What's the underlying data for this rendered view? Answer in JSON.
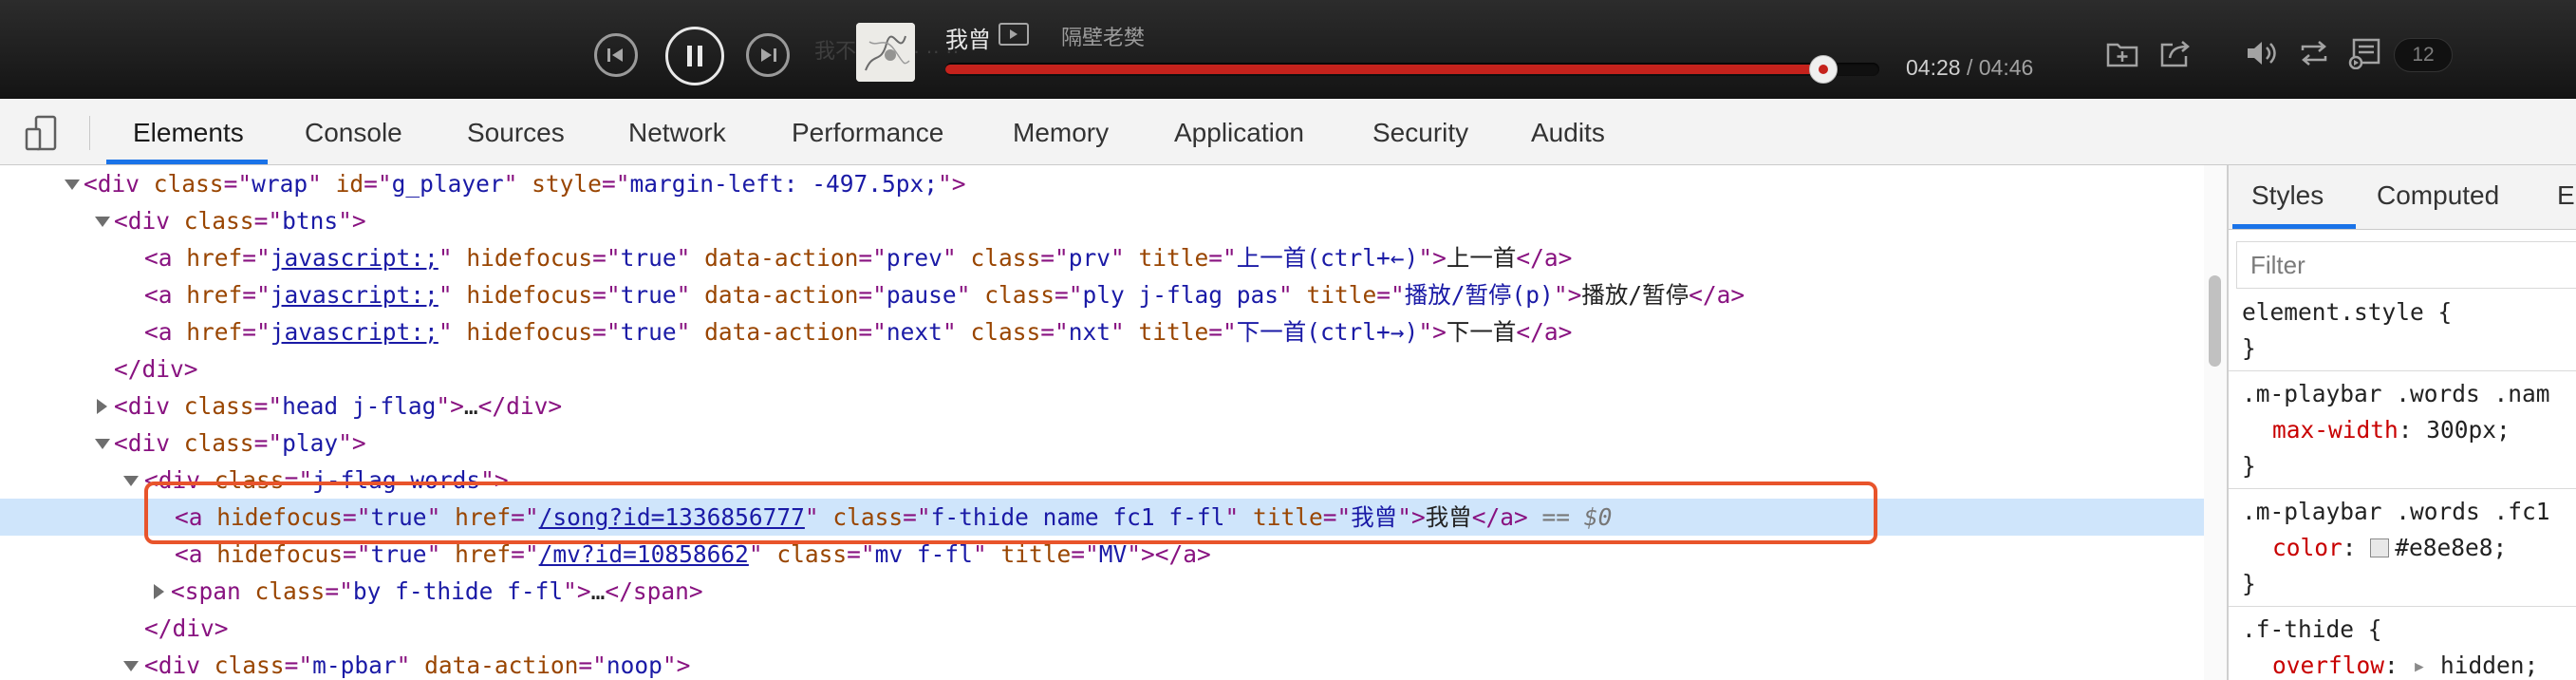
{
  "player": {
    "song": "我曾",
    "artist": "隔壁老樊",
    "ghost_text": "我不··· 1 · · ·· ··",
    "current_time": "04:28",
    "total_time": "04:46",
    "progress": 0.94,
    "playlist_count": "12",
    "colors": {
      "accent": "#c5221c",
      "bar": "#1e1e1e"
    }
  },
  "devtools": {
    "tabs": [
      {
        "label": "Elements",
        "active": true
      },
      {
        "label": "Console"
      },
      {
        "label": "Sources"
      },
      {
        "label": "Network"
      },
      {
        "label": "Performance"
      },
      {
        "label": "Memory"
      },
      {
        "label": "Application"
      },
      {
        "label": "Security"
      },
      {
        "label": "Audits"
      }
    ],
    "tree": {
      "l1": {
        "tag": "div",
        "a1": "class",
        "v1": "wrap",
        "a2": "id",
        "v2": "g_player",
        "a3": "style",
        "v3": "margin-left: -497.5px;"
      },
      "l2": {
        "tag": "div",
        "a1": "class",
        "v1": "btns"
      },
      "l3": {
        "href": "javascript:;",
        "hidefocus": "true",
        "action": "prev",
        "cls": "prv",
        "title": "上一首(ctrl+←)",
        "text": "上一首"
      },
      "l4": {
        "href": "javascript:;",
        "hidefocus": "true",
        "action": "pause",
        "cls": "ply j-flag pas",
        "title": "播放/暂停(p)",
        "text": "播放/暂停"
      },
      "l5": {
        "href": "javascript:;",
        "hidefocus": "true",
        "action": "next",
        "cls": "nxt",
        "title": "下一首(ctrl+→)",
        "text": "下一首"
      },
      "l6": {
        "tag": "div"
      },
      "l7": {
        "tag": "div",
        "cls": "head j-flag",
        "ell": "…"
      },
      "l8": {
        "tag": "div",
        "cls": "play"
      },
      "l9": {
        "tag": "div",
        "cls": "j-flag words"
      },
      "l10": {
        "hidefocus": "true",
        "href": "/song?id=1336856777",
        "cls": "f-thide name fc1 f-fl",
        "title": "我曾",
        "text": "我曾",
        "eq": "==",
        "var": "$0"
      },
      "l11": {
        "hidefocus": "true",
        "href": "/mv?id=10858662",
        "cls": "mv f-fl",
        "title": "MV"
      },
      "l12": {
        "tag": "span",
        "cls": "by f-thide f-fl",
        "ell": "…"
      },
      "l13": {
        "tag": "div"
      },
      "l14": {
        "tag": "div",
        "cls": "m-pbar",
        "action": "noop"
      }
    }
  },
  "styles_pane": {
    "tabs": [
      "Styles",
      "Computed",
      "E"
    ],
    "filter_placeholder": "Filter",
    "rules": [
      {
        "selector": "element.style {",
        "close": "}"
      },
      {
        "selector": ".m-playbar .words .nam",
        "prop": "max-width",
        "value": "300px;",
        "close": "}"
      },
      {
        "selector": ".m-playbar .words .fc1",
        "prop": "color",
        "value": "#e8e8e8;",
        "close": "}"
      },
      {
        "selector": ".f-thide {",
        "prop": "overflow",
        "value": "hidden;"
      }
    ]
  }
}
